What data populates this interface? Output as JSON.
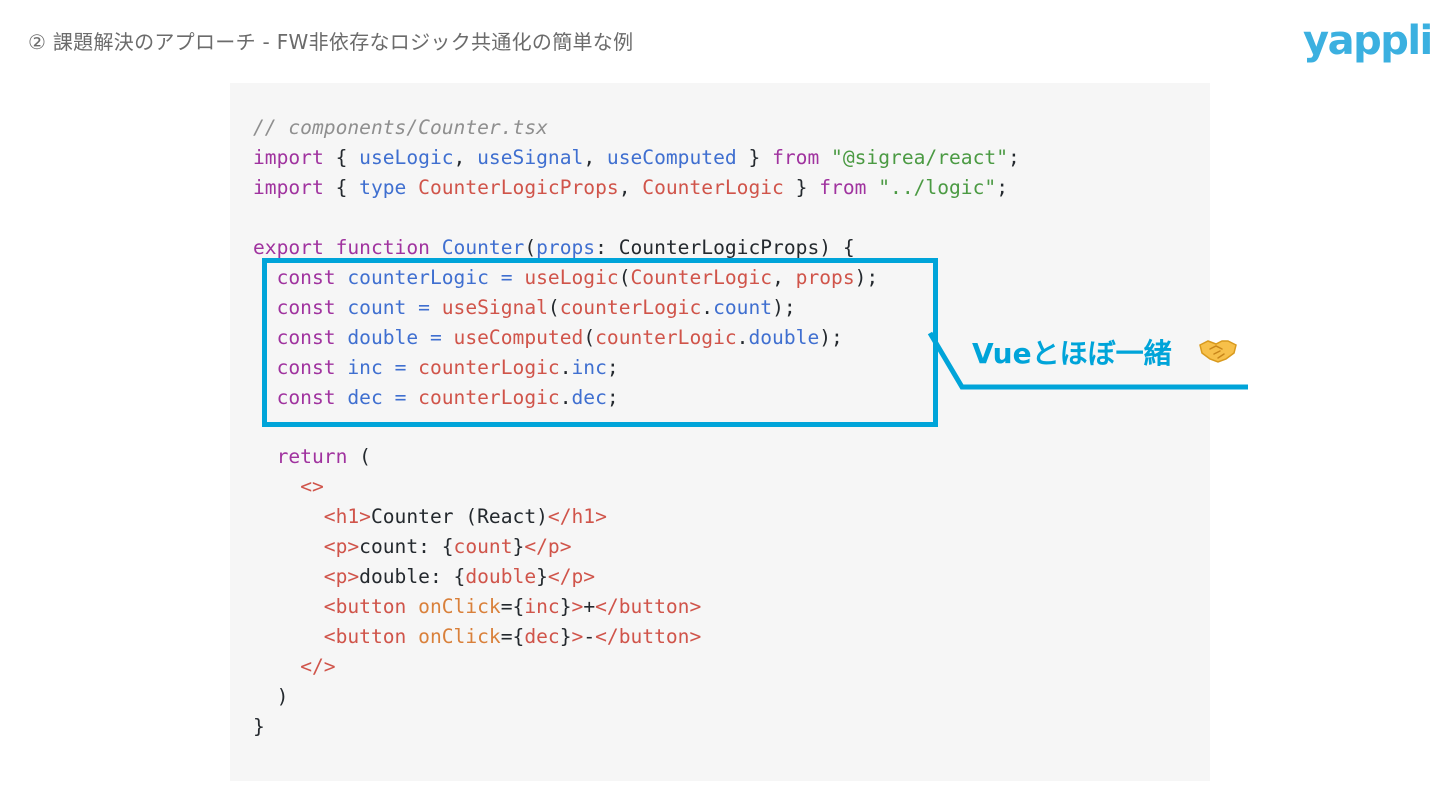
{
  "header": {
    "title": "② 課題解決のアプローチ - FW非依存なロジック共通化の簡単な例",
    "logo_text": "yappli"
  },
  "callout": {
    "text": "Vueとほぼ一緒",
    "icon": "handshake-icon"
  },
  "colors": {
    "accent": "#00a4d9",
    "logo": "#3bb0e0",
    "code_background": "#f6f6f6",
    "keyword": "#a0339f",
    "function": "#3f6fd0",
    "type": "#d0544a",
    "string": "#4b9a43",
    "comment": "#8f8f8f",
    "attribute": "#d9803a"
  },
  "code": {
    "lines": [
      [
        {
          "t": "// components/Counter.tsx",
          "c": "cm"
        }
      ],
      [
        {
          "t": "import",
          "c": "kw"
        },
        {
          "t": " { ",
          "c": "pl"
        },
        {
          "t": "useLogic",
          "c": "fn"
        },
        {
          "t": ", ",
          "c": "pl"
        },
        {
          "t": "useSignal",
          "c": "fn"
        },
        {
          "t": ", ",
          "c": "pl"
        },
        {
          "t": "useComputed",
          "c": "fn"
        },
        {
          "t": " } ",
          "c": "pl"
        },
        {
          "t": "from",
          "c": "kw"
        },
        {
          "t": " ",
          "c": "pl"
        },
        {
          "t": "\"@sigrea/react\"",
          "c": "st"
        },
        {
          "t": ";",
          "c": "pl"
        }
      ],
      [
        {
          "t": "import",
          "c": "kw"
        },
        {
          "t": " { ",
          "c": "pl"
        },
        {
          "t": "type",
          "c": "fn"
        },
        {
          "t": " ",
          "c": "pl"
        },
        {
          "t": "CounterLogicProps",
          "c": "ty"
        },
        {
          "t": ", ",
          "c": "pl"
        },
        {
          "t": "CounterLogic",
          "c": "ty"
        },
        {
          "t": " } ",
          "c": "pl"
        },
        {
          "t": "from",
          "c": "kw"
        },
        {
          "t": " ",
          "c": "pl"
        },
        {
          "t": "\"../logic\"",
          "c": "st"
        },
        {
          "t": ";",
          "c": "pl"
        }
      ],
      [],
      [
        {
          "t": "export",
          "c": "kw"
        },
        {
          "t": " ",
          "c": "pl"
        },
        {
          "t": "function",
          "c": "kw"
        },
        {
          "t": " ",
          "c": "pl"
        },
        {
          "t": "Counter",
          "c": "fn"
        },
        {
          "t": "(",
          "c": "pl"
        },
        {
          "t": "props",
          "c": "fn"
        },
        {
          "t": ": CounterLogicProps) {",
          "c": "pl"
        }
      ],
      [
        {
          "t": "  ",
          "c": "pl"
        },
        {
          "t": "const",
          "c": "kw"
        },
        {
          "t": " ",
          "c": "pl"
        },
        {
          "t": "counterLogic",
          "c": "fn"
        },
        {
          "t": " ",
          "c": "pl"
        },
        {
          "t": "=",
          "c": "fn"
        },
        {
          "t": " ",
          "c": "pl"
        },
        {
          "t": "useLogic",
          "c": "ty"
        },
        {
          "t": "(",
          "c": "pl"
        },
        {
          "t": "CounterLogic",
          "c": "ty"
        },
        {
          "t": ", ",
          "c": "pl"
        },
        {
          "t": "props",
          "c": "ty"
        },
        {
          "t": ");",
          "c": "pl"
        }
      ],
      [
        {
          "t": "  ",
          "c": "pl"
        },
        {
          "t": "const",
          "c": "kw"
        },
        {
          "t": " ",
          "c": "pl"
        },
        {
          "t": "count",
          "c": "fn"
        },
        {
          "t": " ",
          "c": "pl"
        },
        {
          "t": "=",
          "c": "fn"
        },
        {
          "t": " ",
          "c": "pl"
        },
        {
          "t": "useSignal",
          "c": "ty"
        },
        {
          "t": "(",
          "c": "pl"
        },
        {
          "t": "counterLogic",
          "c": "ty"
        },
        {
          "t": ".",
          "c": "pl"
        },
        {
          "t": "count",
          "c": "fn"
        },
        {
          "t": ");",
          "c": "pl"
        }
      ],
      [
        {
          "t": "  ",
          "c": "pl"
        },
        {
          "t": "const",
          "c": "kw"
        },
        {
          "t": " ",
          "c": "pl"
        },
        {
          "t": "double",
          "c": "fn"
        },
        {
          "t": " ",
          "c": "pl"
        },
        {
          "t": "=",
          "c": "fn"
        },
        {
          "t": " ",
          "c": "pl"
        },
        {
          "t": "useComputed",
          "c": "ty"
        },
        {
          "t": "(",
          "c": "pl"
        },
        {
          "t": "counterLogic",
          "c": "ty"
        },
        {
          "t": ".",
          "c": "pl"
        },
        {
          "t": "double",
          "c": "fn"
        },
        {
          "t": ");",
          "c": "pl"
        }
      ],
      [
        {
          "t": "  ",
          "c": "pl"
        },
        {
          "t": "const",
          "c": "kw"
        },
        {
          "t": " ",
          "c": "pl"
        },
        {
          "t": "inc",
          "c": "fn"
        },
        {
          "t": " ",
          "c": "pl"
        },
        {
          "t": "=",
          "c": "fn"
        },
        {
          "t": " ",
          "c": "pl"
        },
        {
          "t": "counterLogic",
          "c": "ty"
        },
        {
          "t": ".",
          "c": "pl"
        },
        {
          "t": "inc",
          "c": "fn"
        },
        {
          "t": ";",
          "c": "pl"
        }
      ],
      [
        {
          "t": "  ",
          "c": "pl"
        },
        {
          "t": "const",
          "c": "kw"
        },
        {
          "t": " ",
          "c": "pl"
        },
        {
          "t": "dec",
          "c": "fn"
        },
        {
          "t": " ",
          "c": "pl"
        },
        {
          "t": "=",
          "c": "fn"
        },
        {
          "t": " ",
          "c": "pl"
        },
        {
          "t": "counterLogic",
          "c": "ty"
        },
        {
          "t": ".",
          "c": "pl"
        },
        {
          "t": "dec",
          "c": "fn"
        },
        {
          "t": ";",
          "c": "pl"
        }
      ],
      [],
      [
        {
          "t": "  ",
          "c": "pl"
        },
        {
          "t": "return",
          "c": "kw"
        },
        {
          "t": " (",
          "c": "pl"
        }
      ],
      [
        {
          "t": "    ",
          "c": "pl"
        },
        {
          "t": "<>",
          "c": "tg"
        }
      ],
      [
        {
          "t": "      ",
          "c": "pl"
        },
        {
          "t": "<h1>",
          "c": "tg"
        },
        {
          "t": "Counter (React)",
          "c": "pl"
        },
        {
          "t": "</h1>",
          "c": "tg"
        }
      ],
      [
        {
          "t": "      ",
          "c": "pl"
        },
        {
          "t": "<p>",
          "c": "tg"
        },
        {
          "t": "count: {",
          "c": "pl"
        },
        {
          "t": "count",
          "c": "ty"
        },
        {
          "t": "}",
          "c": "pl"
        },
        {
          "t": "</p>",
          "c": "tg"
        }
      ],
      [
        {
          "t": "      ",
          "c": "pl"
        },
        {
          "t": "<p>",
          "c": "tg"
        },
        {
          "t": "double: {",
          "c": "pl"
        },
        {
          "t": "double",
          "c": "ty"
        },
        {
          "t": "}",
          "c": "pl"
        },
        {
          "t": "</p>",
          "c": "tg"
        }
      ],
      [
        {
          "t": "      ",
          "c": "pl"
        },
        {
          "t": "<button",
          "c": "tg"
        },
        {
          "t": " ",
          "c": "pl"
        },
        {
          "t": "onClick",
          "c": "at"
        },
        {
          "t": "={",
          "c": "pl"
        },
        {
          "t": "inc",
          "c": "ty"
        },
        {
          "t": "}",
          "c": "pl"
        },
        {
          "t": ">",
          "c": "tg"
        },
        {
          "t": "+",
          "c": "pl"
        },
        {
          "t": "</button>",
          "c": "tg"
        }
      ],
      [
        {
          "t": "      ",
          "c": "pl"
        },
        {
          "t": "<button",
          "c": "tg"
        },
        {
          "t": " ",
          "c": "pl"
        },
        {
          "t": "onClick",
          "c": "at"
        },
        {
          "t": "={",
          "c": "pl"
        },
        {
          "t": "dec",
          "c": "ty"
        },
        {
          "t": "}",
          "c": "pl"
        },
        {
          "t": ">",
          "c": "tg"
        },
        {
          "t": "-",
          "c": "pl"
        },
        {
          "t": "</button>",
          "c": "tg"
        }
      ],
      [
        {
          "t": "    ",
          "c": "pl"
        },
        {
          "t": "</>",
          "c": "tg"
        }
      ],
      [
        {
          "t": "  )",
          "c": "pl"
        }
      ],
      [
        {
          "t": "}",
          "c": "pl"
        }
      ]
    ]
  }
}
